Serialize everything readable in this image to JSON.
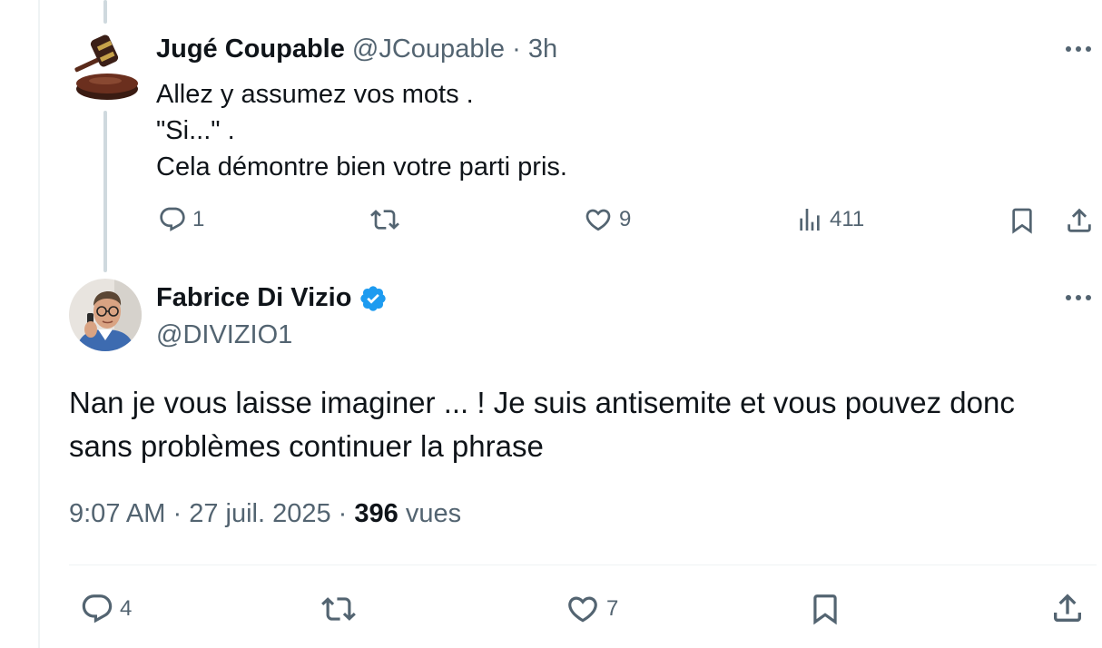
{
  "reply": {
    "author_name": "Jugé Coupable",
    "handle": "@JCoupable",
    "separator": "·",
    "time": "3h",
    "lines": [
      "Allez y assumez vos mots .",
      "\"Si...\" .",
      "Cela démontre bien votre parti pris."
    ],
    "reply_count": "1",
    "like_count": "9",
    "view_count": "411",
    "avatar_icon": "gavel-icon"
  },
  "main": {
    "author_name": "Fabrice Di Vizio",
    "handle": "@DIVIZIO1",
    "verified_color": "#1d9bf0",
    "lines": [
      "Nan je vous laisse imaginer ... ! Je suis antisemite et vous pouvez donc",
      "sans problèmes continuer la phrase"
    ],
    "time": "9:07 AM",
    "date": "27 juil. 2025",
    "separator": "·",
    "views": "396",
    "views_label": "vues",
    "reply_count": "4",
    "like_count": "7"
  },
  "colors": {
    "text": "#0f1419",
    "secondary": "#536471",
    "thread_line": "#cfd9de",
    "accent": "#1d9bf0"
  }
}
